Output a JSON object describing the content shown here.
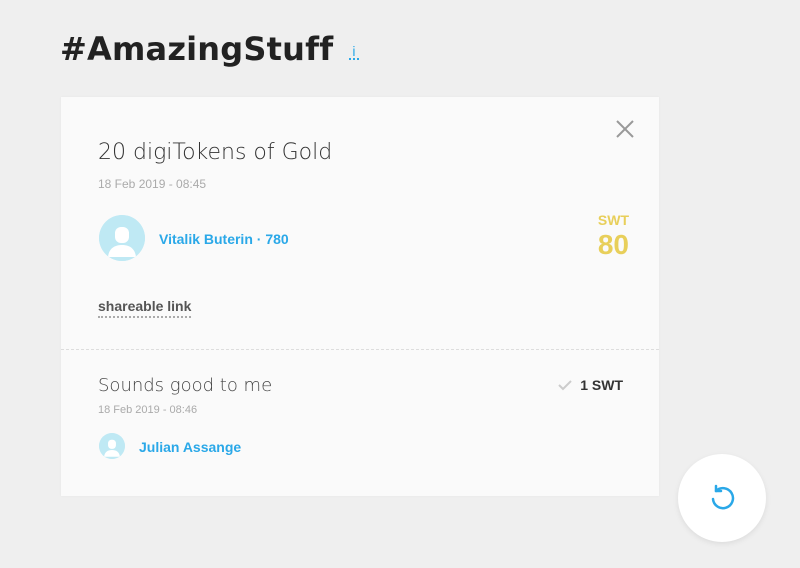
{
  "header": {
    "title": "#AmazingStuff",
    "info_label": "i"
  },
  "offer": {
    "title": "20 digiTokens of Gold",
    "date": "18 Feb 2019 - 08:45",
    "user": "Vitalik Buterin · 780",
    "currency": "SWT",
    "amount": "80",
    "share_label": "shareable link"
  },
  "reply": {
    "text": "Sounds good to me",
    "date": "18 Feb 2019 - 08:46",
    "amount": "1 SWT",
    "user": "Julian Assange"
  },
  "icons": {
    "close": "close-icon",
    "check": "check-icon",
    "undo": "undo-icon",
    "avatar": "avatar-icon"
  },
  "colors": {
    "accent": "#2aa8e8",
    "gold": "#e8cf5a",
    "avatar_bg": "#bfe9f4",
    "background": "#efefef"
  }
}
